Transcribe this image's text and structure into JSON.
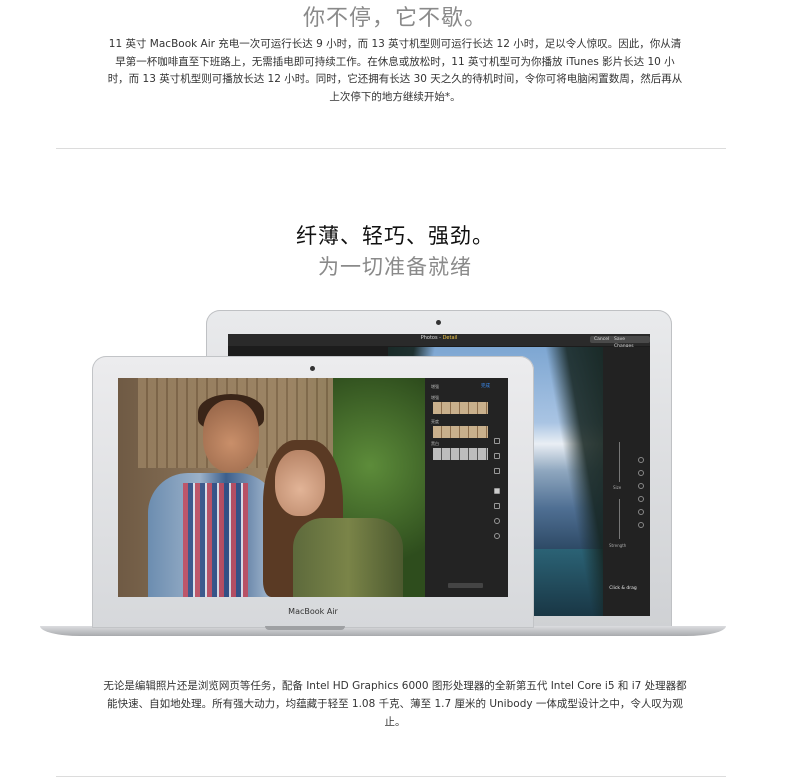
{
  "top": {
    "subtitle": "你不停，它不歇。",
    "paragraph": "11 英寸 MacBook Air 充电一次可运行长达 9 小时，而 13 英寸机型则可运行长达 12 小时，足以令人惊叹。因此，你从清早第一杯咖啡直至下班路上，无需插电即可持续工作。在休息或放松时，11 英寸机型可为你播放 iTunes 影片长达 10 小时，而 13 英寸机型则可播放长达 12 小时。同时，它还拥有长达 30 天之久的待机时间，令你可将电脑闲置数周，然后再从上次停下的地方继续开始*。"
  },
  "section": {
    "headline": "纤薄、轻巧、强劲。",
    "subheadline": "为一切准备就绪"
  },
  "back_laptop": {
    "app_title_prefix": "Photos - ",
    "app_title_highlight": "Detail",
    "cancel_label": "Cancel",
    "save_label": "Save Changes",
    "size_label": "Size",
    "strength_label": "Strength",
    "drag_hint": "Click & drag"
  },
  "front_laptop": {
    "done_label": "完成",
    "brand_label": "MacBook Air",
    "panel_labels": [
      "增强",
      "亮度",
      "黑白"
    ]
  },
  "bottom": {
    "paragraph": "无论是编辑照片还是浏览网页等任务，配备 Intel HD Graphics 6000 图形处理器的全新第五代 Intel Core i5 和 i7 处理器都能快速、自如地处理。所有强大动力，均蕴藏于轻至 1.08 千克、薄至 1.7 厘米的 Unibody 一体成型设计之中，令人叹为观止。"
  },
  "colors": {
    "headline": "#111111",
    "subheadline_gray": "#8a8a8a",
    "accent_blue": "#3b8df5",
    "accent_yellow": "#f2c94c"
  }
}
